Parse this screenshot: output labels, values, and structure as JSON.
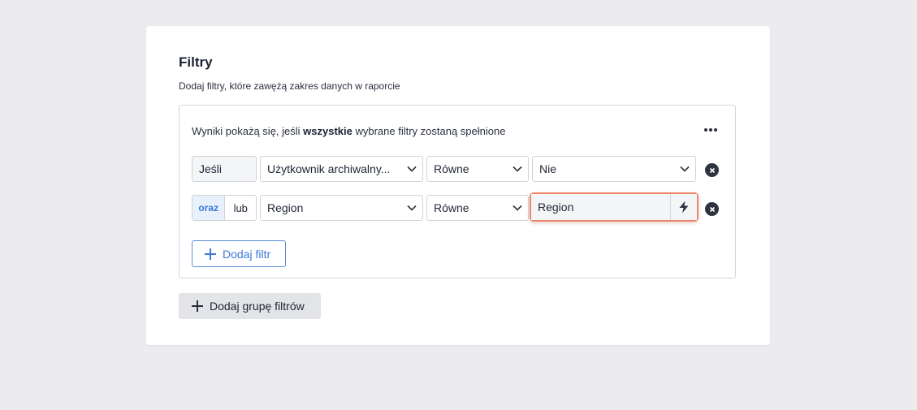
{
  "card": {
    "title": "Filtry",
    "subtitle": "Dodaj filtry, które zawężą zakres danych w raporcie"
  },
  "group": {
    "desc_prefix": "Wyniki pokażą się, jeśli ",
    "desc_bold": "wszystkie",
    "desc_suffix": " wybrane filtry zostaną spełnione",
    "more_icon": "more-horizontal-icon"
  },
  "rows": [
    {
      "connector": "Jeśli",
      "field": "Użytkownik archiwalny...",
      "operator": "Równe",
      "value": "Nie"
    },
    {
      "connector_options": [
        "oraz",
        "lub"
      ],
      "connector_selected": "oraz",
      "field": "Region",
      "operator": "Równe",
      "value": "Region",
      "value_icon": "lightning-bolt-icon"
    }
  ],
  "buttons": {
    "add_filter": "Dodaj filtr",
    "add_group": "Dodaj grupę filtrów"
  },
  "colors": {
    "accent": "#3b79d4",
    "focus_ring": "#ee8468",
    "remove_icon": "#2f3340"
  }
}
